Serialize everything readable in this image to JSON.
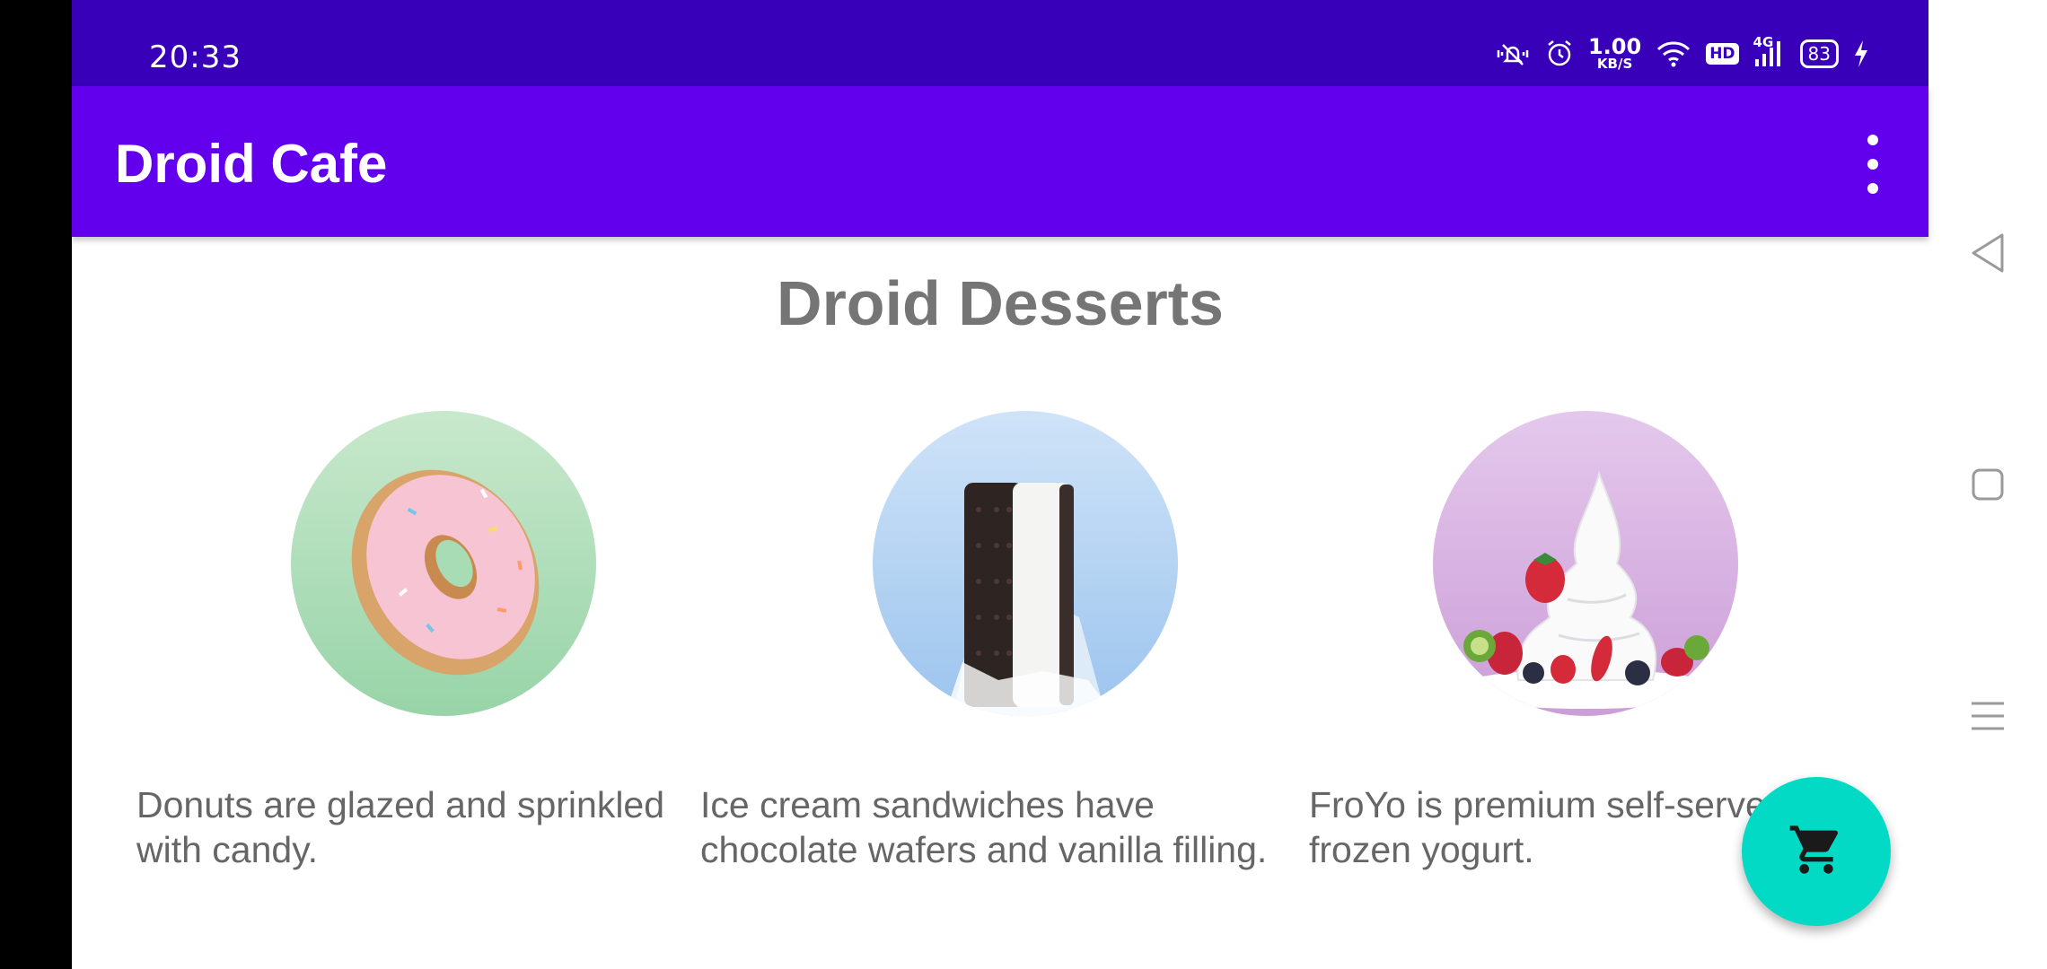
{
  "status_bar": {
    "time": "20:33",
    "net_speed_value": "1.00",
    "net_speed_unit": "KB/S",
    "hd_label": "HD",
    "network_type": "4G",
    "battery_level": "83",
    "icons": [
      "mute-vibrate-icon",
      "alarm-icon",
      "wifi-icon",
      "signal-icon",
      "charging-icon"
    ]
  },
  "app_bar": {
    "title": "Droid Cafe",
    "menu_icon": "more-vert-icon"
  },
  "main": {
    "heading": "Droid Desserts",
    "desserts": [
      {
        "name": "donut",
        "description": "Donuts are glazed and sprinkled with candy.",
        "bg_color": "#a8dcb4"
      },
      {
        "name": "ice-cream-sandwich",
        "description": "Ice cream sandwiches have chocolate wafers and vanilla filling.",
        "bg_color": "#b4d4f4"
      },
      {
        "name": "froyo",
        "description": "FroYo is premium self-serve frozen yogurt.",
        "bg_color": "#dcbce8"
      }
    ]
  },
  "fab": {
    "icon": "shopping-cart-icon",
    "color": "#03dac5"
  },
  "colors": {
    "status_bar": "#3800b8",
    "app_bar": "#6200ee",
    "heading_text": "#757575",
    "body_text": "#666666"
  },
  "nav_bar": {
    "buttons": [
      "back-icon",
      "home-icon",
      "recents-icon"
    ]
  }
}
